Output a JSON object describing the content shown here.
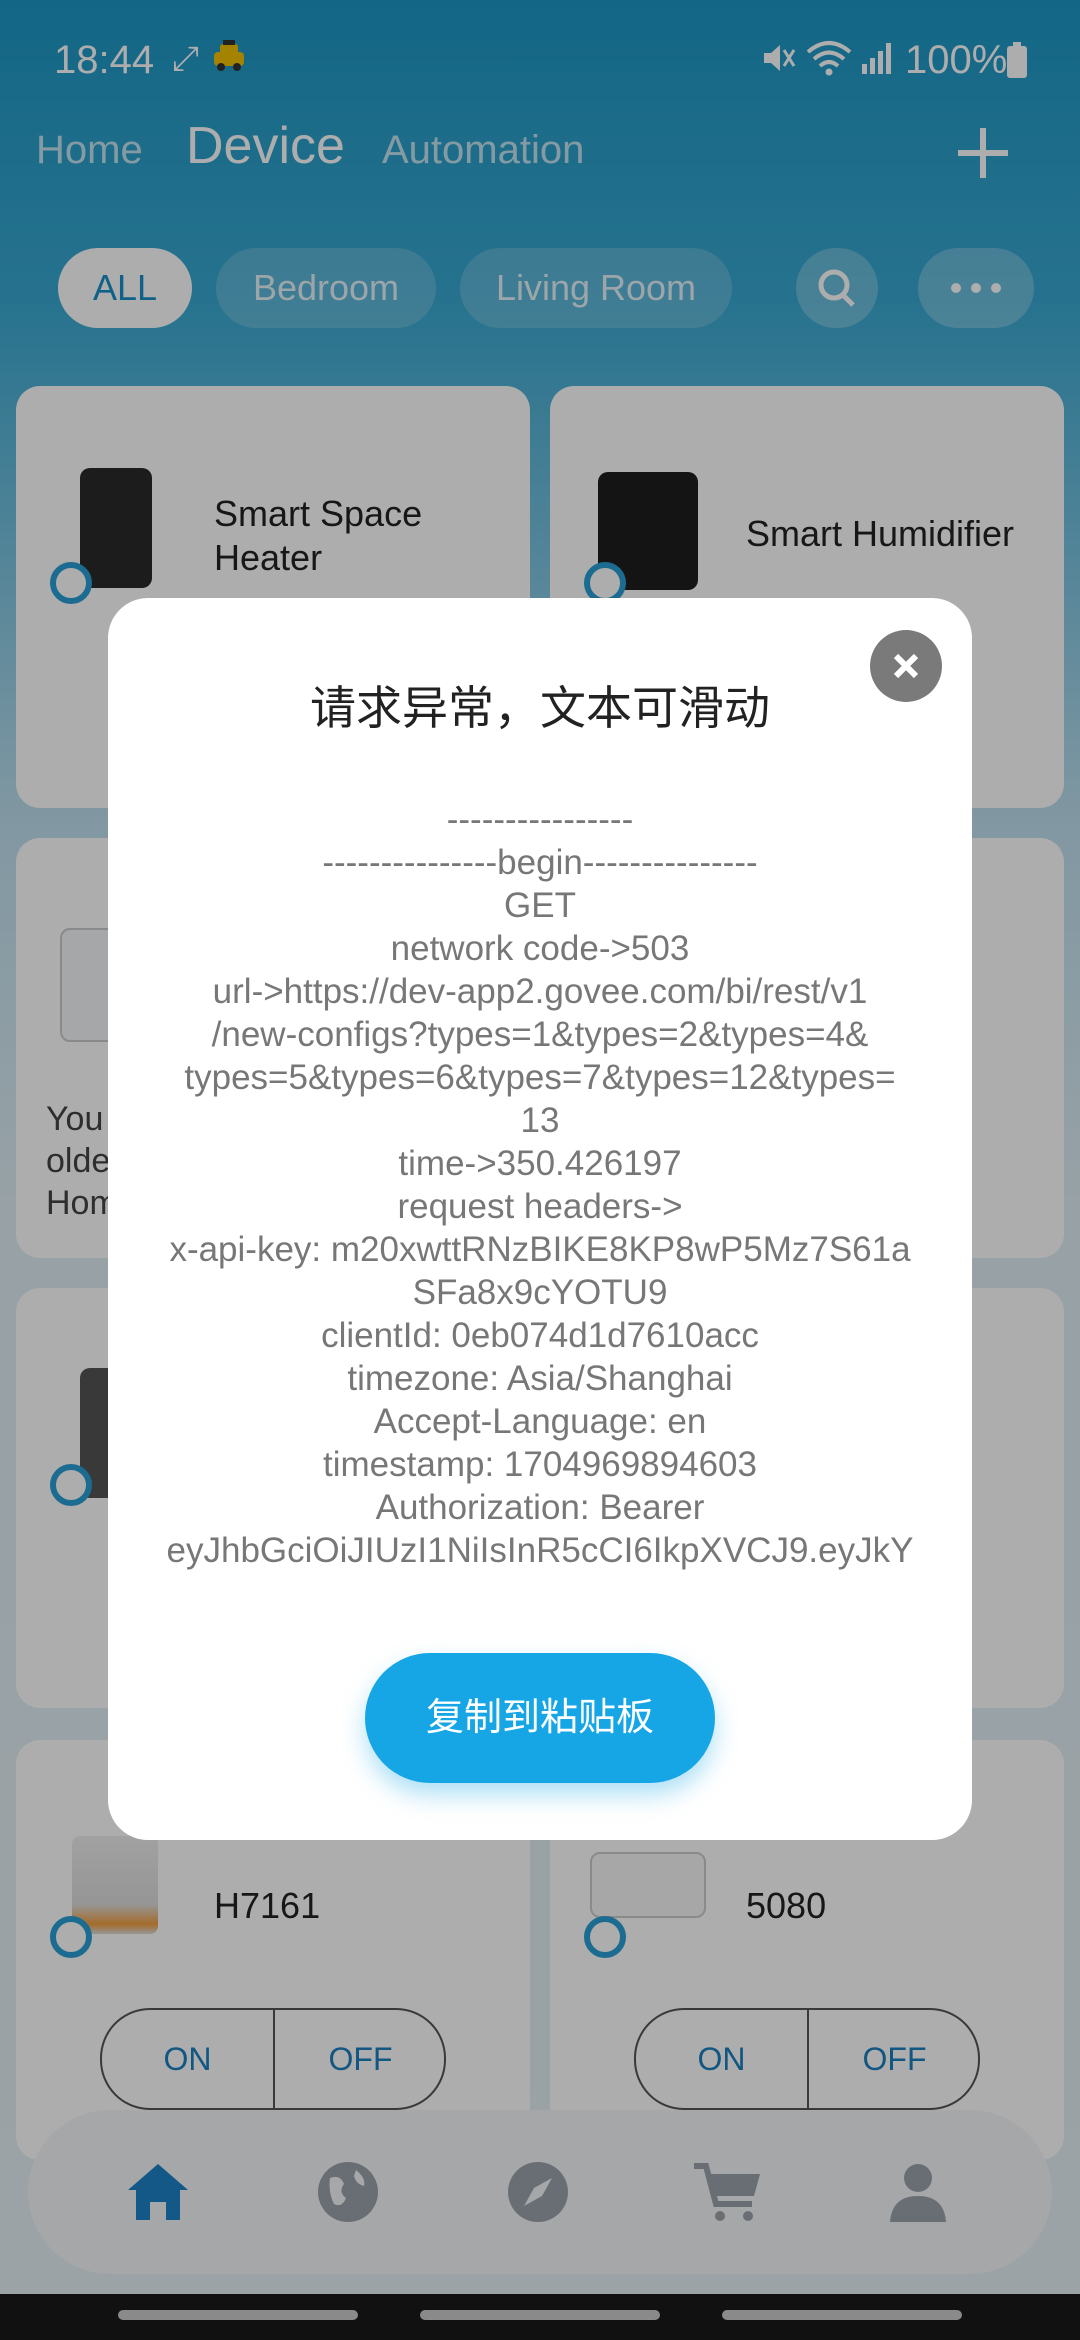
{
  "status_bar": {
    "time": "18:44",
    "battery": "100%"
  },
  "nav": {
    "tabs": [
      "Home",
      "Device",
      "Automation"
    ],
    "active": "Device"
  },
  "filters": [
    "ALL",
    "Bedroom",
    "Living Room"
  ],
  "devices": [
    {
      "name": "Smart Space Heater"
    },
    {
      "name": "Smart Humidifier"
    },
    {
      "name_partial": "You\nolde\nHom"
    },
    {
      "name": ""
    },
    {
      "name": "H7161",
      "on": "ON",
      "off": "OFF"
    },
    {
      "name": "5080",
      "on": "ON",
      "off": "OFF"
    }
  ],
  "dialog": {
    "title": "请求异常，文本可滑动",
    "lines": [
      "----------------",
      "---------------begin---------------",
      "GET",
      "network code->503",
      "url->https://dev-app2.govee.com/bi/rest/v1",
      "/new-configs?types=1&types=2&types=4&",
      "types=5&types=6&types=7&types=12&types=",
      "13",
      "time->350.426197",
      "request headers->",
      "x-api-key: m20xwttRNzBIKE8KP8wP5Mz7S61a",
      "SFa8x9cYOTU9",
      "clientId: 0eb074d1d7610acc",
      "timezone: Asia/Shanghai",
      "Accept-Language: en",
      "timestamp: 1704969894603",
      "Authorization: Bearer",
      "eyJhbGciOiJIUzI1NiIsInR5cCI6IkpXVCJ9.eyJkY"
    ],
    "copy_button": "复制到粘贴板"
  },
  "colors": {
    "accent": "#16a6e6",
    "header": "#1d97c6"
  }
}
